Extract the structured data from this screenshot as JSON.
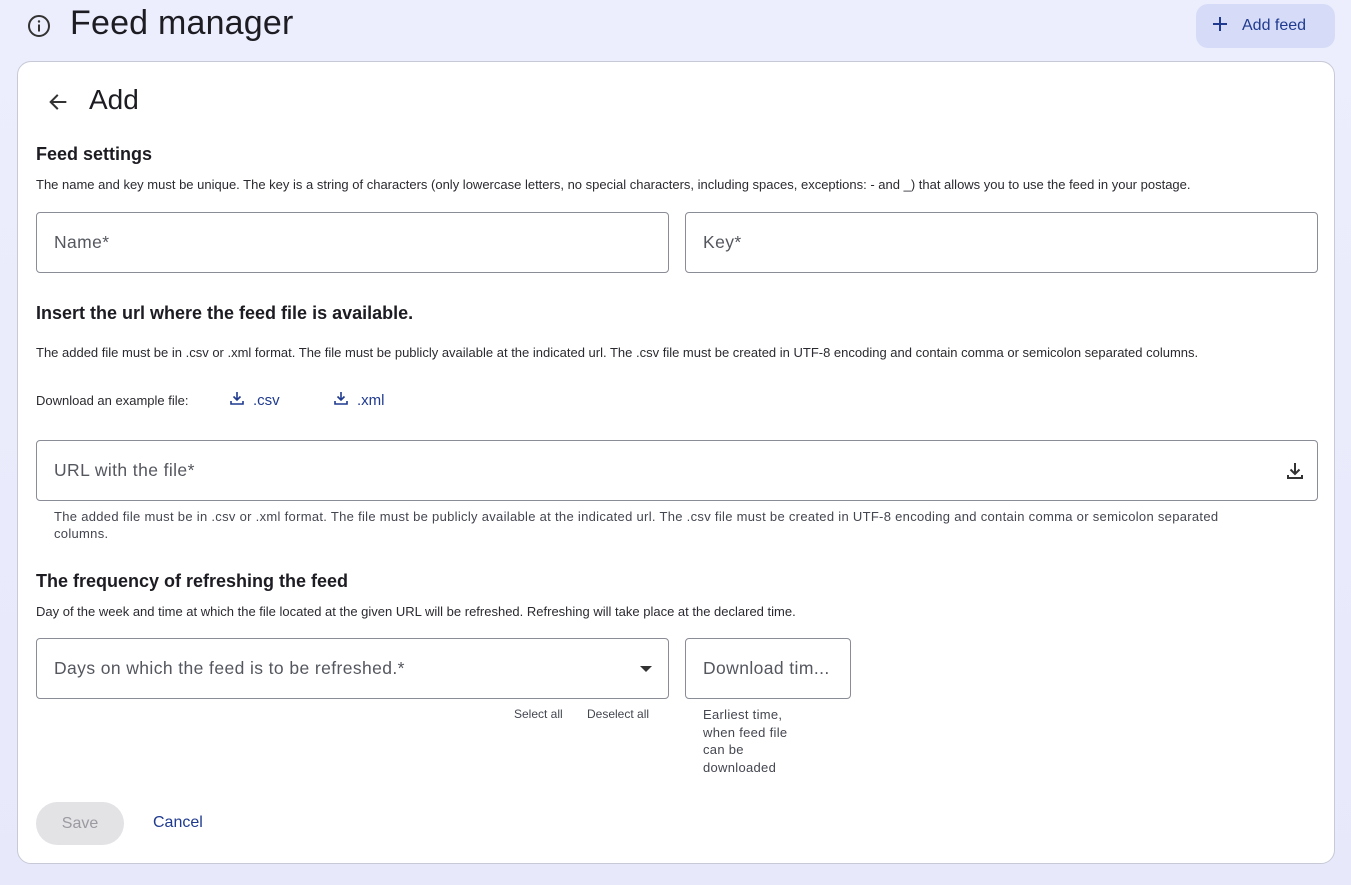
{
  "header": {
    "title": "Feed manager",
    "add_feed_label": "Add feed"
  },
  "card": {
    "title": "Add"
  },
  "feed_settings": {
    "title": "Feed settings",
    "description": "The name and key must be unique. The key is a string of characters (only lowercase letters, no special characters, including spaces, exceptions: - and _) that allows you to use the feed in your postage.",
    "name_placeholder": "Name",
    "key_placeholder": "Key",
    "required_mark": "*"
  },
  "url_section": {
    "title": "Insert the url where the feed file is available.",
    "description": "The added file must be in .csv or .xml format. The file must be publicly available at the indicated url. The .csv file must be created in UTF-8 encoding and contain comma or semicolon separated columns.",
    "download_label": "Download an example file:",
    "csv_link": ".csv",
    "xml_link": ".xml",
    "url_placeholder": "URL with the file",
    "helper": "The added file must be in .csv or .xml format. The file must be publicly available at the indicated url. The .csv file must be created in UTF-8 encoding and contain comma or semicolon separated columns."
  },
  "frequency": {
    "title": "The frequency of refreshing the feed",
    "description": "Day of the week and time at which the file located at the given URL will be refreshed. Refreshing will take place at the declared time.",
    "days_placeholder": "Days on which the feed is to be refreshed.",
    "select_all": "Select all",
    "deselect_all": "Deselect all",
    "time_placeholder": "Download tim...",
    "time_helper": "Earliest time, when feed file can be downloaded"
  },
  "actions": {
    "save": "Save",
    "cancel": "Cancel"
  },
  "colors": {
    "accent": "#1f3a8f",
    "button_bg": "#d6dcf7",
    "page_bg": "#eceefd"
  }
}
